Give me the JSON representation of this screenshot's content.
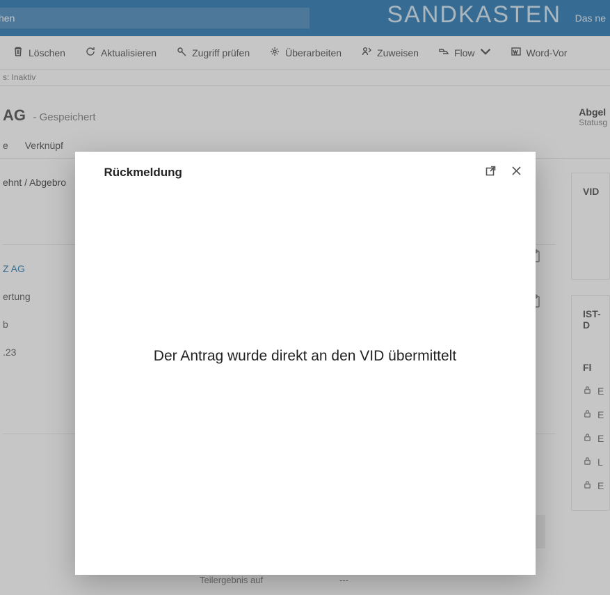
{
  "topbar": {
    "search_value": "hen",
    "brand": "SANDKASTEN",
    "right_link": "Das ne"
  },
  "commands": {
    "delete": "Löschen",
    "refresh": "Aktualisieren",
    "check_access": "Zugriff prüfen",
    "revise": "Überarbeiten",
    "assign": "Zuweisen",
    "flow": "Flow",
    "word": "Word-Vor"
  },
  "statusline": "s: Inaktiv",
  "header": {
    "entity": "AG",
    "state": "- Gespeichert",
    "right_label": "Abgel",
    "right_sub": "Statusg"
  },
  "tabs": {
    "t1": "e",
    "t2": "Verknüpf"
  },
  "left_panel": {
    "status_fragment": "ehnt / Abgebro",
    "link_text": "Z AG",
    "row1": "ertung",
    "row2": "b",
    "row3": ".23"
  },
  "right_cards": {
    "vid_title": "VID",
    "ist_title": "IST-D",
    "fl_label": "Fl",
    "lock_a": "E",
    "lock_b": "E",
    "lock_c": "E",
    "lock_d": "L",
    "lock_e": "E"
  },
  "cut_row": {
    "left": "Teilergebnis auf",
    "right": "---"
  },
  "dialog": {
    "title": "Rückmeldung",
    "message": "Der Antrag wurde direkt an den VID übermittelt"
  }
}
